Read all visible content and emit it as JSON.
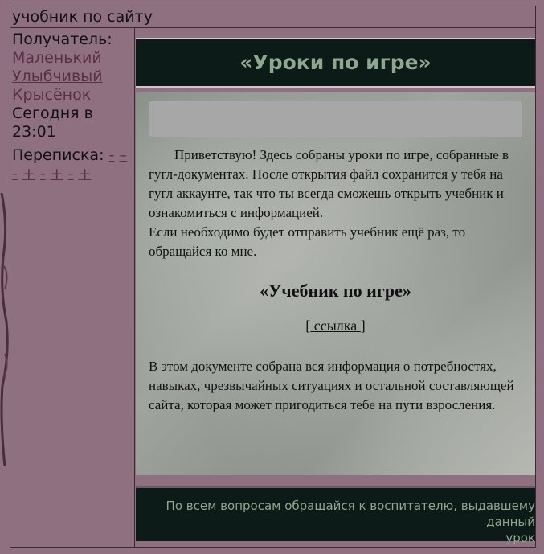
{
  "subject": "учобник по сайту",
  "recipient": {
    "label": "Получатель:",
    "name_line1": "Маленький",
    "name_line2": "Улыбчивый",
    "name_line3": "Крысёнок"
  },
  "date": {
    "line1": "Сегодня в",
    "line2": "23:01"
  },
  "thread": {
    "label": "Переписка:",
    "links": [
      "-",
      "–",
      "-",
      "+",
      "-",
      "+",
      "-",
      "+"
    ]
  },
  "banner_title": "«Уроки по игре»",
  "intro_paragraph": "Приветствую! Здесь собраны уроки по игре, собранные в гугл-документах. После открытия файл сохранится у тебя на гугл аккаунте, так что ты всегда сможешь открыть учебник и ознакомиться с информацией.",
  "intro_paragraph2": "Если необходимо будет отправить учебник ещё раз, то обращайся ко мне.",
  "doc_title": "«Учебник по игре»",
  "link": {
    "open": "[",
    "text": " ссылка ",
    "close": "]"
  },
  "doc_description": "В этом документе собрана вся информация о потребностях, навыках, чрезвычайных ситуациях и остальной составляющей сайта, которая может пригодиться тебе на пути взросления.",
  "footer_line1": "По всем вопросам обращайся к воспитателю, выдавшему данный",
  "footer_line2": "урок"
}
